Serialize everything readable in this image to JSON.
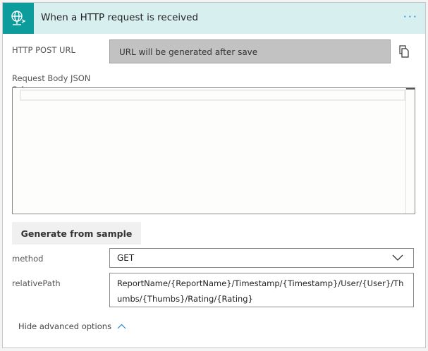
{
  "header": {
    "title": "When a HTTP request is received",
    "icon": "globe-request-icon",
    "more_label": "···",
    "accent": "#0d9c9c",
    "background": "#d8eff0"
  },
  "fields": {
    "url_label": "HTTP POST URL",
    "url_value": "URL will be generated after save",
    "schema_label": "Request Body JSON Schema",
    "schema_value": "",
    "generate_label": "Generate from sample",
    "method_label": "method",
    "method_value": "GET",
    "path_label": "relativePath",
    "path_value": "ReportName/{ReportName}/Timestamp/{Timestamp}/User/{User}/Thumbs/{Thumbs}/Rating/{Rating}"
  },
  "advanced": {
    "label": "Hide advanced options"
  }
}
